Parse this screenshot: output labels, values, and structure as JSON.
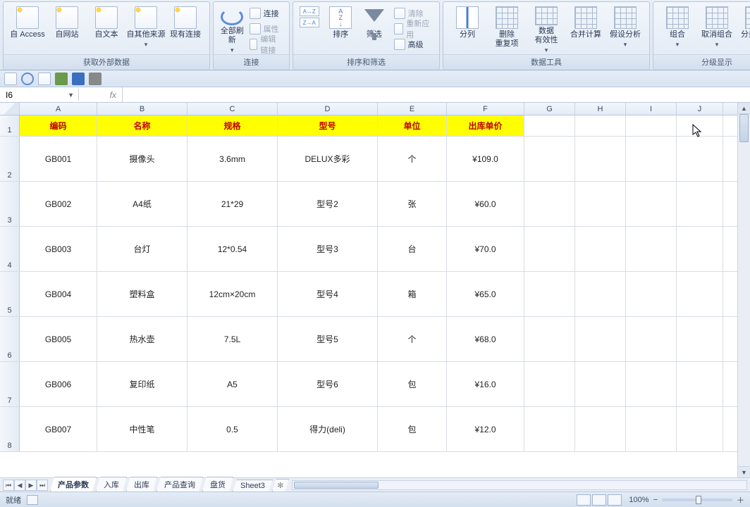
{
  "ribbon": {
    "groups": [
      {
        "label": "获取外部数据",
        "kind": "ext",
        "buttons": [
          {
            "id": "from-access",
            "label": "自 Access"
          },
          {
            "id": "from-web",
            "label": "自网站"
          },
          {
            "id": "from-text",
            "label": "自文本"
          },
          {
            "id": "from-other",
            "label": "自其他来源",
            "dd": true
          },
          {
            "id": "existing-conn",
            "label": "现有连接"
          }
        ]
      },
      {
        "label": "连接",
        "kind": "conn",
        "buttons": [
          {
            "id": "refresh-all",
            "label": "全部刷新",
            "dd": true
          }
        ],
        "minis": [
          {
            "id": "connections",
            "label": "连接"
          },
          {
            "id": "properties",
            "label": "属性",
            "dis": true
          },
          {
            "id": "edit-links",
            "label": "编辑链接",
            "dis": true
          }
        ]
      },
      {
        "label": "排序和筛选",
        "kind": "sort",
        "buttons": [
          {
            "id": "sort-az",
            "label": "",
            "stack": true
          },
          {
            "id": "sort",
            "label": "排序"
          },
          {
            "id": "filter",
            "label": "筛选"
          }
        ],
        "minis": [
          {
            "id": "clear",
            "label": "清除",
            "dis": true
          },
          {
            "id": "reapply",
            "label": "重新应用",
            "dis": true
          },
          {
            "id": "advanced",
            "label": "高级"
          }
        ]
      },
      {
        "label": "数据工具",
        "kind": "tools",
        "buttons": [
          {
            "id": "text-to-cols",
            "label": "分列"
          },
          {
            "id": "remove-dup",
            "label": "删除\n重复项"
          },
          {
            "id": "data-valid",
            "label": "数据\n有效性",
            "dd": true
          },
          {
            "id": "consolidate",
            "label": "合并计算"
          },
          {
            "id": "whatif",
            "label": "假设分析",
            "dd": true
          }
        ]
      },
      {
        "label": "分级显示",
        "kind": "outline",
        "buttons": [
          {
            "id": "group",
            "label": "组合",
            "dd": true
          },
          {
            "id": "ungroup",
            "label": "取消组合",
            "dd": true
          },
          {
            "id": "subtotal",
            "label": "分类汇总"
          }
        ]
      }
    ]
  },
  "namebox": "I6",
  "columns": [
    "A",
    "B",
    "C",
    "D",
    "E",
    "F",
    "G",
    "H",
    "I",
    "J"
  ],
  "header_row": [
    "编码",
    "名称",
    "规格",
    "型号",
    "单位",
    "出库单价"
  ],
  "data_rows": [
    [
      "GB001",
      "摄像头",
      "3.6mm",
      "DELUX多彩",
      "个",
      "¥109.0"
    ],
    [
      "GB002",
      "A4纸",
      "21*29",
      "型号2",
      "张",
      "¥60.0"
    ],
    [
      "GB003",
      "台灯",
      "12*0.54",
      "型号3",
      "台",
      "¥70.0"
    ],
    [
      "GB004",
      "塑料盒",
      "12cm×20cm",
      "型号4",
      "箱",
      "¥65.0"
    ],
    [
      "GB005",
      "热水壶",
      "7.5L",
      "型号5",
      "个",
      "¥68.0"
    ],
    [
      "GB006",
      "复印纸",
      "A5",
      "型号6",
      "包",
      "¥16.0"
    ],
    [
      "GB007",
      "中性笔",
      "0.5",
      "得力(deli)",
      "包",
      "¥12.0"
    ]
  ],
  "sheet_tabs": [
    "产品参数",
    "入库",
    "出库",
    "产品查询",
    "盘货",
    "Sheet3"
  ],
  "status": {
    "ready": "就绪",
    "zoom": "100%"
  }
}
